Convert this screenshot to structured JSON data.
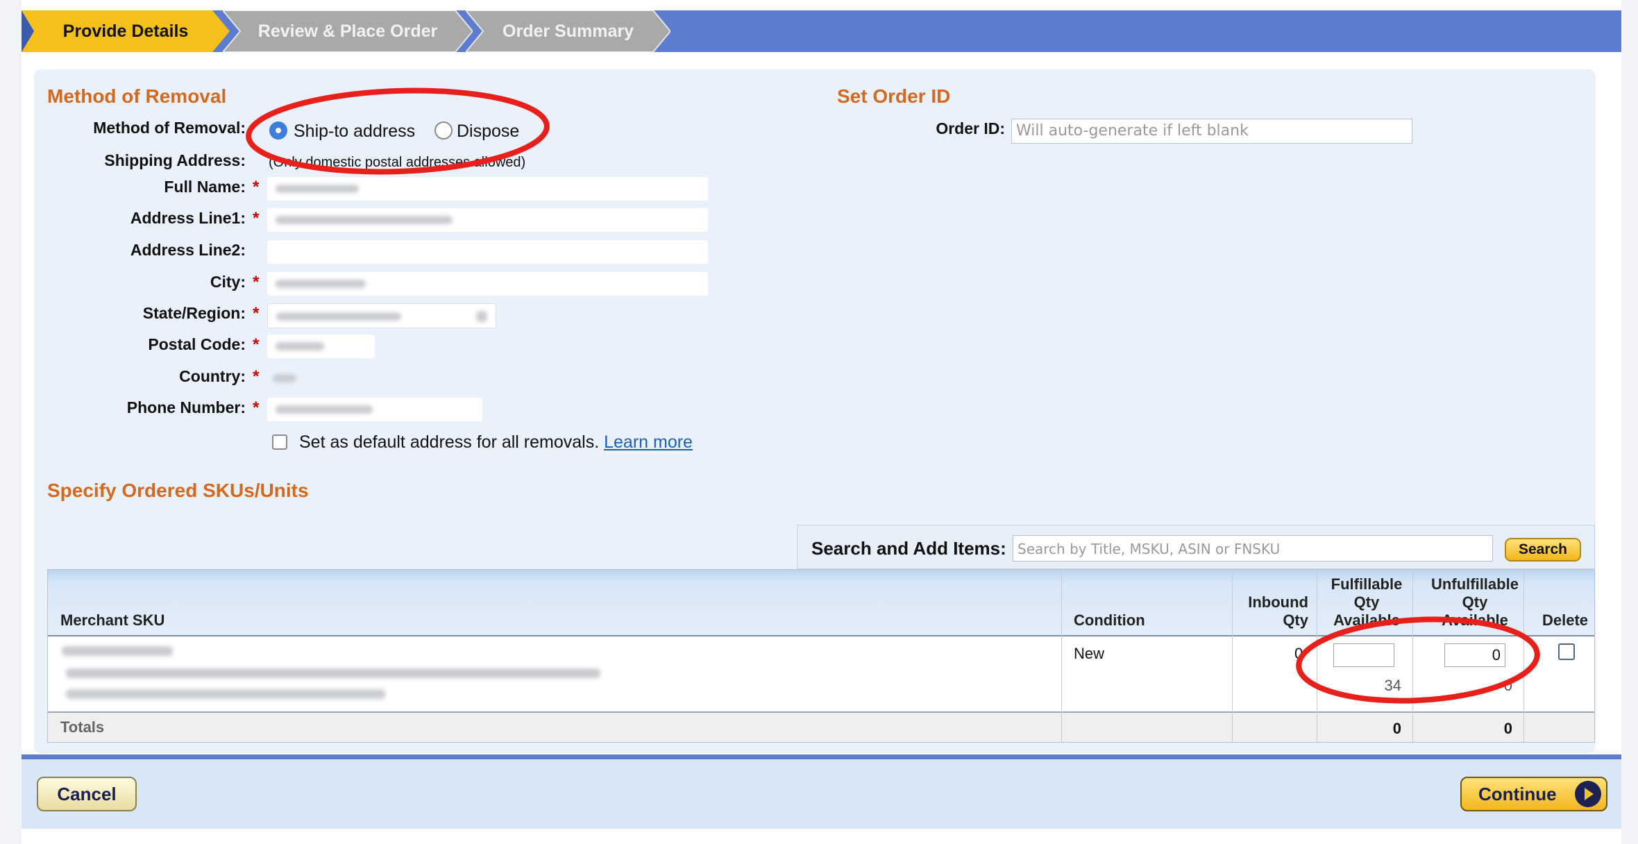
{
  "steps": [
    {
      "label": "Provide Details",
      "state": "active",
      "color": "#f5c01b"
    },
    {
      "label": "Review & Place Order",
      "state": "inactive",
      "color": "#a9a9a9"
    },
    {
      "label": "Order Summary",
      "state": "inactive",
      "color": "#a9a9a9"
    }
  ],
  "method_section": {
    "title": "Method of Removal",
    "method_label": "Method of Removal:",
    "options": [
      {
        "label": "Ship-to address",
        "selected": true
      },
      {
        "label": "Dispose",
        "selected": false
      }
    ],
    "shipping_label": "Shipping Address:",
    "shipping_note": "(Only domestic postal addresses allowed)",
    "fields": [
      {
        "label": "Full Name:",
        "required": true
      },
      {
        "label": "Address Line1:",
        "required": true
      },
      {
        "label": "Address Line2:",
        "required": false
      },
      {
        "label": "City:",
        "required": true
      },
      {
        "label": "State/Region:",
        "required": true
      },
      {
        "label": "Postal Code:",
        "required": true
      },
      {
        "label": "Country:",
        "required": true
      },
      {
        "label": "Phone Number:",
        "required": true
      }
    ],
    "required_mark": "*",
    "default_checkbox": {
      "label": "Set as default address for all removals.",
      "link": "Learn more",
      "checked": false
    }
  },
  "order_section": {
    "title": "Set Order ID",
    "order_label": "Order ID:",
    "order_placeholder": "Will auto-generate if left blank"
  },
  "skus_section": {
    "title": "Specify Ordered SKUs/Units",
    "search_label": "Search and Add Items:",
    "search_placeholder": "Search by Title, MSKU, ASIN or FNSKU",
    "search_button": "Search"
  },
  "table": {
    "headers": {
      "merchant_sku": "Merchant SKU",
      "condition": "Condition",
      "inbound_1": "Inbound",
      "inbound_2": "Qty",
      "fulfillable_1": "Fulfillable",
      "fulfillable_2": "Qty",
      "fulfillable_3": "Available",
      "unfulfillable_1": "Unfulfillable",
      "unfulfillable_2": "Qty",
      "unfulfillable_3": "Available",
      "delete": "Delete"
    },
    "rows": [
      {
        "condition": "New",
        "inbound": "0",
        "fulfillable_value": "",
        "fulfillable_available": "34",
        "unfulfillable_value": "0",
        "unfulfillable_available": "0"
      }
    ],
    "totals": {
      "label": "Totals",
      "fulfillable": "0",
      "unfulfillable": "0"
    }
  },
  "footer": {
    "cancel": "Cancel",
    "continue": "Continue"
  },
  "colors": {
    "accent_blue": "#5b7ccf",
    "section_title": "#d2691e",
    "annotation_red": "#e8201c"
  }
}
